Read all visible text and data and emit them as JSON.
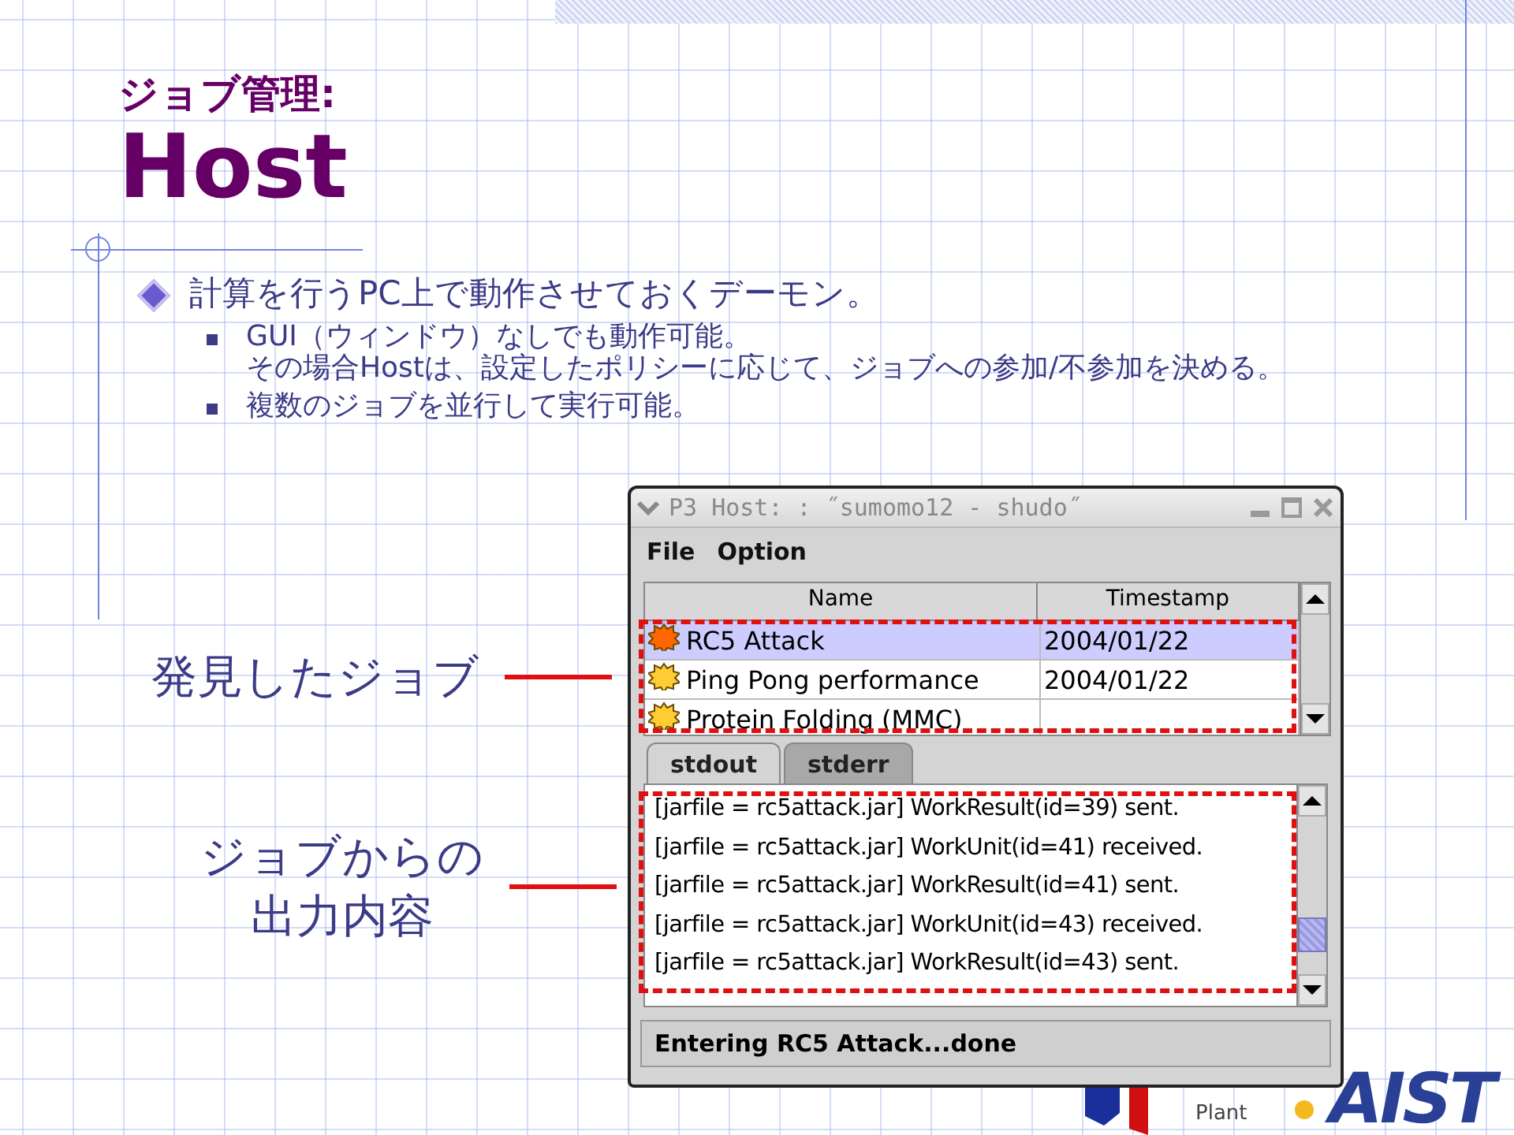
{
  "slide": {
    "heading": "ジョブ管理:",
    "title": "Host"
  },
  "bullets": [
    {
      "text": "計算を行うPC上で動作させておくデーモン。",
      "children": [
        {
          "lines": [
            "GUI（ウィンドウ）なしでも動作可能。",
            "その場合Hostは、設定したポリシーに応じて、ジョブへの参加/不参加を決める。"
          ]
        },
        {
          "lines": [
            "複数のジョブを並行して実行可能。"
          ]
        }
      ]
    }
  ],
  "window": {
    "title": "P3 Host: : ˝sumomo12 - shudo˝",
    "menu": [
      "File",
      "Option"
    ],
    "table": {
      "columns": [
        "Name",
        "Timestamp"
      ],
      "rows": [
        {
          "name": "RC5 Attack",
          "timestamp": "2004/01/22",
          "selected": true,
          "color": "#ff6600"
        },
        {
          "name": "Ping Pong performance",
          "timestamp": "2004/01/22",
          "selected": false,
          "color": "#ffcc33"
        },
        {
          "name": "Protein Folding (MMC)",
          "selected": false,
          "color": "#ffcc33"
        }
      ]
    },
    "tabs": [
      {
        "label": "stdout",
        "selected": true
      },
      {
        "label": "stderr",
        "selected": false
      }
    ],
    "output": [
      "[jarfile = rc5attack.jar] WorkResult(id=39) sent.",
      "[jarfile = rc5attack.jar] WorkUnit(id=41) received.",
      "[jarfile = rc5attack.jar] WorkResult(id=41) sent.",
      "[jarfile = rc5attack.jar] WorkUnit(id=43) received.",
      "[jarfile = rc5attack.jar] WorkResult(id=43) sent."
    ],
    "status_bar": "Entering RC5 Attack...done"
  },
  "callouts": [
    {
      "lines": [
        "発見したジョブ"
      ]
    },
    {
      "lines": [
        "ジョブからの",
        "出力内容"
      ]
    }
  ],
  "logos": {
    "plant_text": "Plant",
    "aist_text": "AIST"
  }
}
